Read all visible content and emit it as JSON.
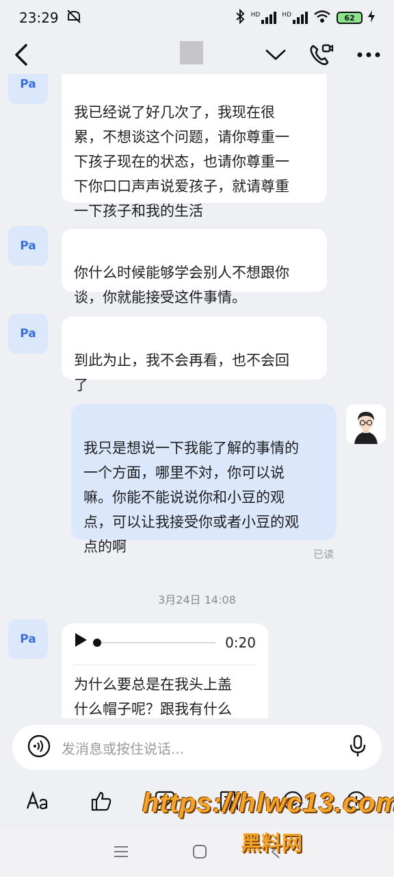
{
  "status": {
    "time": "23:29",
    "network1": "HD",
    "network2": "HD",
    "battery": "62"
  },
  "chat": {
    "messages": [
      {
        "sender": "Pa",
        "text": "我已经说了好几次了，我现在很\n累，不想谈这个问题，请你尊重一\n下孩子现在的状态，也请你尊重一\n下你口口声声说爱孩子，就请尊重\n一下孩子和我的生活"
      },
      {
        "sender": "Pa",
        "text": "你什么时候能够学会别人不想跟你\n谈，你就能接受这件事情。"
      },
      {
        "sender": "Pa",
        "text": "到此为止，我不会再看，也不会回\n了"
      },
      {
        "sender": "me",
        "text": "我只是想说一下我能了解的事情的\n一个方面，哪里不対，你可以说\n嘛。你能不能说说你和小豆的观\n点，可以让我接受你或者小豆的观\n点的啊",
        "status": "已读"
      }
    ],
    "timestamp": "3月24日 14:08",
    "voice_message": {
      "sender": "Pa",
      "duration": "0:20",
      "progress": 0,
      "transcript": "为什么要总是在我头上盖\n什么帽子呢？跟我有什么"
    }
  },
  "input": {
    "placeholder": "发消息或按住说话..."
  },
  "watermark": {
    "url": "https://hlwc13.com",
    "name": "黑料网"
  }
}
